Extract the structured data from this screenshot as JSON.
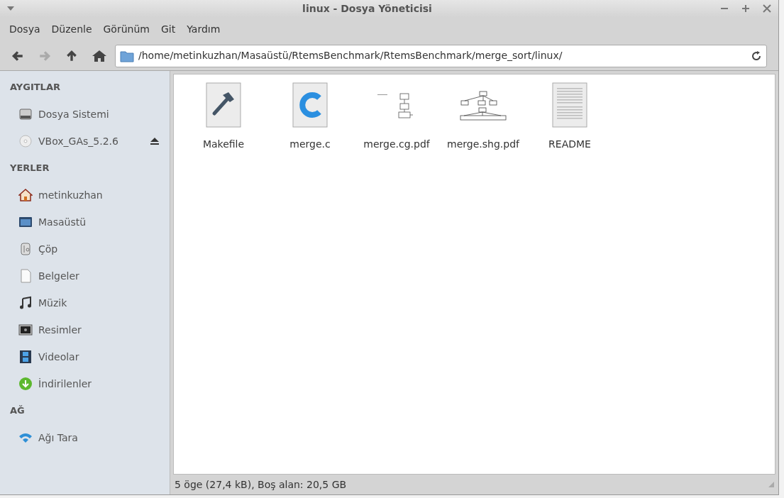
{
  "window": {
    "title": "linux - Dosya Yöneticisi"
  },
  "menu": [
    "Dosya",
    "Düzenle",
    "Görünüm",
    "Git",
    "Yardım"
  ],
  "toolbar": {
    "back_disabled": false,
    "forward_disabled": true,
    "path": "/home/metinkuzhan/Masaüstü/RtemsBenchmark/RtemsBenchmark/merge_sort/linux/"
  },
  "sidebar": [
    {
      "heading": "AYGITLAR",
      "items": [
        {
          "label": "Dosya Sistemi",
          "kind": "drive",
          "ejectable": false
        },
        {
          "label": "VBox_GAs_5.2.6",
          "kind": "disc",
          "ejectable": true
        }
      ]
    },
    {
      "heading": "YERLER",
      "items": [
        {
          "label": "metinkuzhan",
          "kind": "home",
          "ejectable": false
        },
        {
          "label": "Masaüstü",
          "kind": "desktop",
          "ejectable": false
        },
        {
          "label": "Çöp",
          "kind": "trash",
          "ejectable": false
        },
        {
          "label": "Belgeler",
          "kind": "document",
          "ejectable": false
        },
        {
          "label": "Müzik",
          "kind": "music",
          "ejectable": false
        },
        {
          "label": "Resimler",
          "kind": "pictures",
          "ejectable": false
        },
        {
          "label": "Videolar",
          "kind": "video",
          "ejectable": false
        },
        {
          "label": "İndirilenler",
          "kind": "download",
          "ejectable": false
        }
      ]
    },
    {
      "heading": "AĞ",
      "items": [
        {
          "label": "Ağı Tara",
          "kind": "network",
          "ejectable": false
        }
      ]
    }
  ],
  "files": [
    {
      "name": "Makefile",
      "kind": "makefile"
    },
    {
      "name": "merge.c",
      "kind": "c"
    },
    {
      "name": "merge.cg.pdf",
      "kind": "pdf-flow"
    },
    {
      "name": "merge.shg.pdf",
      "kind": "pdf-tree"
    },
    {
      "name": "README",
      "kind": "text"
    }
  ],
  "status_bar": "5 öge (27,4 kB), Boş alan: 20,5 GB"
}
